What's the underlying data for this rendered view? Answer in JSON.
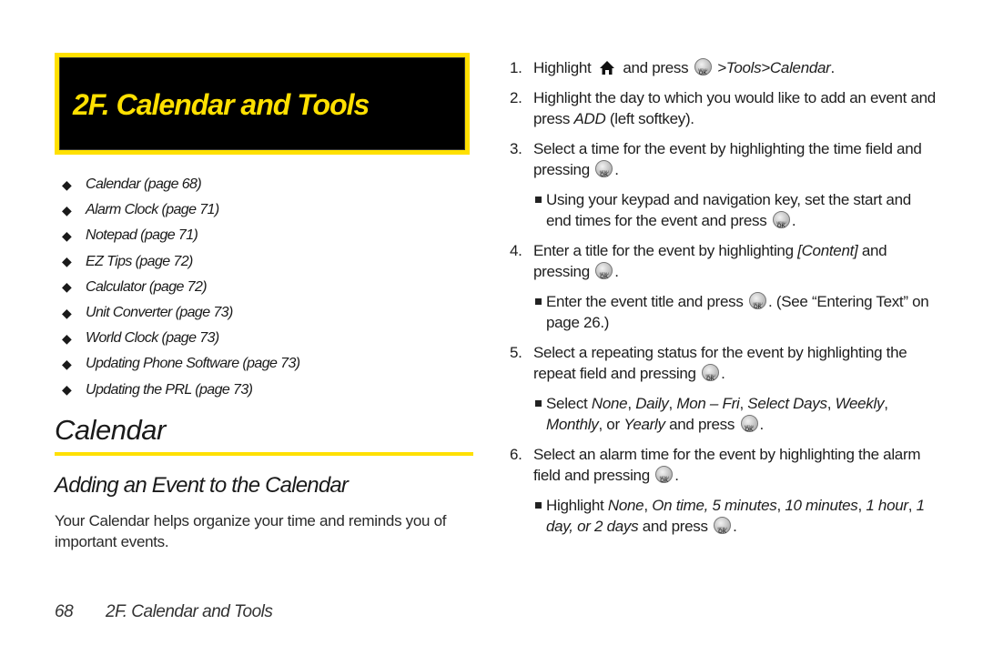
{
  "chapter_banner": {
    "title": "2F.  Calendar and Tools"
  },
  "toc": [
    "Calendar (page 68)",
    "Alarm Clock (page 71)",
    "Notepad (page 71)",
    "EZ Tips (page 72)",
    "Calculator (page 72)",
    "Unit Converter (page 73)",
    "World Clock (page 73)",
    "Updating Phone Software (page 73)",
    "Updating the PRL (page 73)"
  ],
  "section_heading": "Calendar",
  "subsection_heading": "Adding an Event to the Calendar",
  "intro": "Your Calendar helps organize your time and reminds you of important events.",
  "footer": {
    "page_number": "68",
    "chapter": "2F. Calendar and Tools"
  },
  "icons": {
    "home": "home-icon",
    "menu_ok": "menu-ok-key-icon"
  },
  "accent_color": "#ffe000",
  "steps": {
    "s1": {
      "num": "1.",
      "a": "Highlight",
      "b": "and press",
      "c": ">Tools>Calendar",
      "d": "."
    },
    "s2": {
      "num": "2.",
      "a": "Highlight the day to which you would like to add an event and press ",
      "b": "ADD",
      "c": " (left softkey)."
    },
    "s3": {
      "num": "3.",
      "a": "Select a time for the event by highlighting the time field and pressing",
      "b": "."
    },
    "s3_sub": {
      "a": "Using your keypad and navigation key, set the start and end times for the event and press",
      "b": "."
    },
    "s4": {
      "num": "4.",
      "a": "Enter a title for the event by highlighting ",
      "b": "[Content]",
      "c": " and pressing",
      "d": "."
    },
    "s4_sub": {
      "a": "Enter the event title and press",
      "b": ". (See “Entering Text” on page 26.)"
    },
    "s5": {
      "num": "5.",
      "a": "Select a repeating status for the event by highlighting the repeat field and pressing",
      "b": "."
    },
    "s5_sub": {
      "a": "Select ",
      "o1": "None",
      "o2": "Daily",
      "o3": "Mon – Fri",
      "o4": "Select Days",
      "o5": "Weekly",
      "o6": "Monthly",
      "o7": "Yearly",
      "sep": ", ",
      "or": ", or ",
      "b": " and press",
      "c": "."
    },
    "s6": {
      "num": "6.",
      "a": "Select an alarm time for the event by highlighting the alarm field and pressing",
      "b": "."
    },
    "s6_sub": {
      "a": "Highlight ",
      "o1": "None",
      "o2": "On time, 5 minutes",
      "o3": "10 minutes",
      "o4": "1 hour",
      "o5": "1 day, or 2 days",
      "sep": ", ",
      "b": " and press",
      "c": "."
    }
  }
}
